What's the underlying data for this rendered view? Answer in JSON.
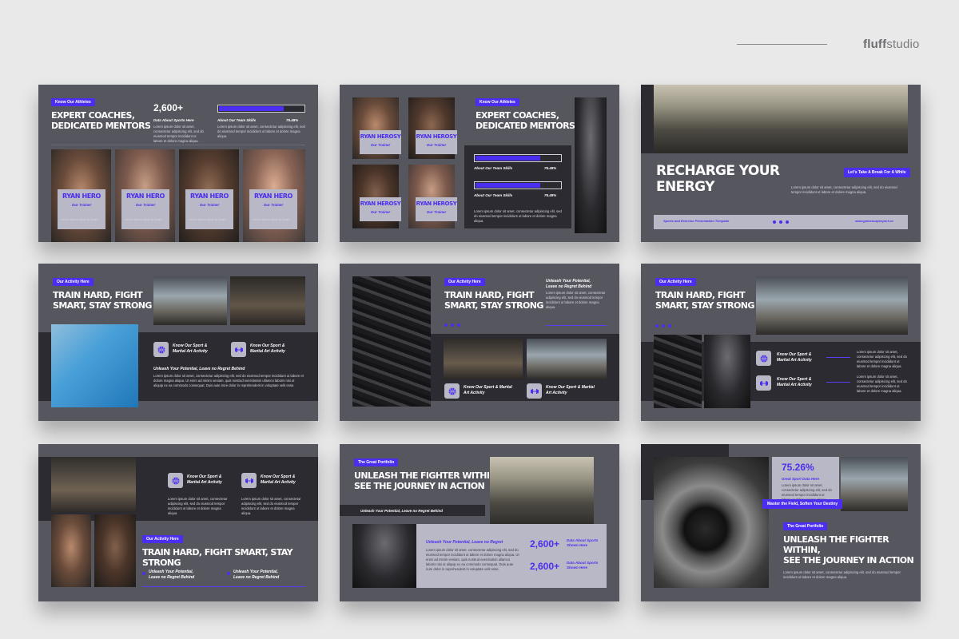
{
  "brand": {
    "bold": "fluff",
    "rest": "studio"
  },
  "colors": {
    "accent": "#4a2ff0",
    "slide_bg": "#56565f",
    "dark_band": "#2b2b31",
    "card": "#b9b8c6"
  },
  "lorem_short": "Lorem ipsum dolor sit amet, consectetur adipiscing elit, sed do eiusmod tempor incididunt ut labore et dolore magna aliqua.",
  "lorem_long": "Lorem ipsum dolor sit amet, consectetur adipiscing elit, sed do eiusmod tempor incididunt ut labore et dolore magna aliqua. Ut enim ad minim veniam, quis nostrud exercitation ullamco laboris nisi ut aliquip ex ea commodo consequat. Duis aute irure dolor in reprehenderit in voluptate velit esse.",
  "lorem_tiny": "Lorem ipsum dolor sit amet",
  "s1": {
    "tag": "Know Our Athletes",
    "title_l1": "EXPERT COACHES,",
    "title_l2": "DEDICATED MENTORS",
    "stat": "2,600+",
    "stat_label": "Data About Sports Here",
    "skill_label": "About Our Team Skills",
    "skill_pct": "76.48%",
    "skill_value": 0.7648,
    "trainers": [
      {
        "name": "RYAN HERO",
        "role": "Our Trainer"
      },
      {
        "name": "RYAN HERO",
        "role": "Our Trainer"
      },
      {
        "name": "RYAN HERO",
        "role": "Our Trainer"
      },
      {
        "name": "RYAN HERO",
        "role": "Our Trainer"
      }
    ]
  },
  "s2": {
    "tag": "Know Our Athletes",
    "title_l1": "EXPERT COACHES,",
    "title_l2": "DEDICATED MENTORS",
    "trainers": [
      {
        "name": "RYAN HEROSY",
        "role": "Our Trainer"
      },
      {
        "name": "RYAN HEROSY",
        "role": "Our Trainer"
      },
      {
        "name": "RYAN HEROSY",
        "role": "Our Trainer"
      },
      {
        "name": "RYAN HEROSY",
        "role": "Our Trainer"
      }
    ],
    "skill_label": "About Our Team Skills",
    "skill_pct": "76.48%",
    "skill_value": 0.7648
  },
  "s3": {
    "title_l1": "RECHARGE YOUR",
    "title_l2": "ENERGY",
    "button": "Let's Take A Break For A While",
    "footer_left": "Sports and Exercise Presentation Template",
    "footer_right": "www.gamescapesport.co"
  },
  "s4": {
    "tag": "Our Activity Here",
    "title_l1": "TRAIN HARD, FIGHT",
    "title_l2": "SMART, STAY STRONG",
    "feature1": "Know Our Sport & Martial Art Activity",
    "feature2": "Know Our Sport & Martial Art Activity",
    "sub": "Unleash Your Potential, Leave no Regret Behind"
  },
  "s5": {
    "tag": "Our Activity Here",
    "title_l1": "TRAIN HARD, FIGHT",
    "title_l2": "SMART, STAY STRONG",
    "sub": "Unleash Your Potential, Leave no Regret Behind",
    "feature1": "Know Our Sport & Martial Art Activity",
    "feature2": "Know Our Sport & Martial Art Activity"
  },
  "s6": {
    "tag": "Our Activity Here",
    "title_l1": "TRAIN HARD, FIGHT",
    "title_l2": "SMART, STAY STRONG",
    "feature1": "Know Our Sport & Martial Art Activity",
    "feature2": "Know Our Sport & Martial Art Activity"
  },
  "s7": {
    "feature1": "Know Our Sport & Martial Art Activity",
    "feature2": "Know Our Sport & Martial Art Activity",
    "tag": "Our Activity Here",
    "title": "TRAIN HARD, FIGHT SMART, STAY STRONG",
    "point1": "Unleash Your Potential, Leave no Regret Behind",
    "point2": "Unleash Your Potential, Leave no Regret Behind"
  },
  "s8": {
    "tag": "The Great Portfolio",
    "title_l1": "UNLEASH THE FIGHTER WITHIN,",
    "title_l2": "SEE THE JOURNEY IN ACTION",
    "sub": "Unleash Your Potential, Leave no Regret Behind",
    "sub2": "Unleash Your Potential, Leave no Regret",
    "stat1": "2,600+",
    "stat1_label": "Data About Sports Shown Here",
    "stat2": "2,600+",
    "stat2_label": "Data About Sports Shown Here"
  },
  "s9": {
    "stat": "75.26%",
    "stat_label": "Great Sport Data Here",
    "button": "Master the Field, Soften Your Destiny",
    "tag": "The Great Portfolio",
    "title_l1": "UNLEASH THE FIGHTER WITHIN,",
    "title_l2": "SEE THE JOURNEY IN ACTION"
  }
}
